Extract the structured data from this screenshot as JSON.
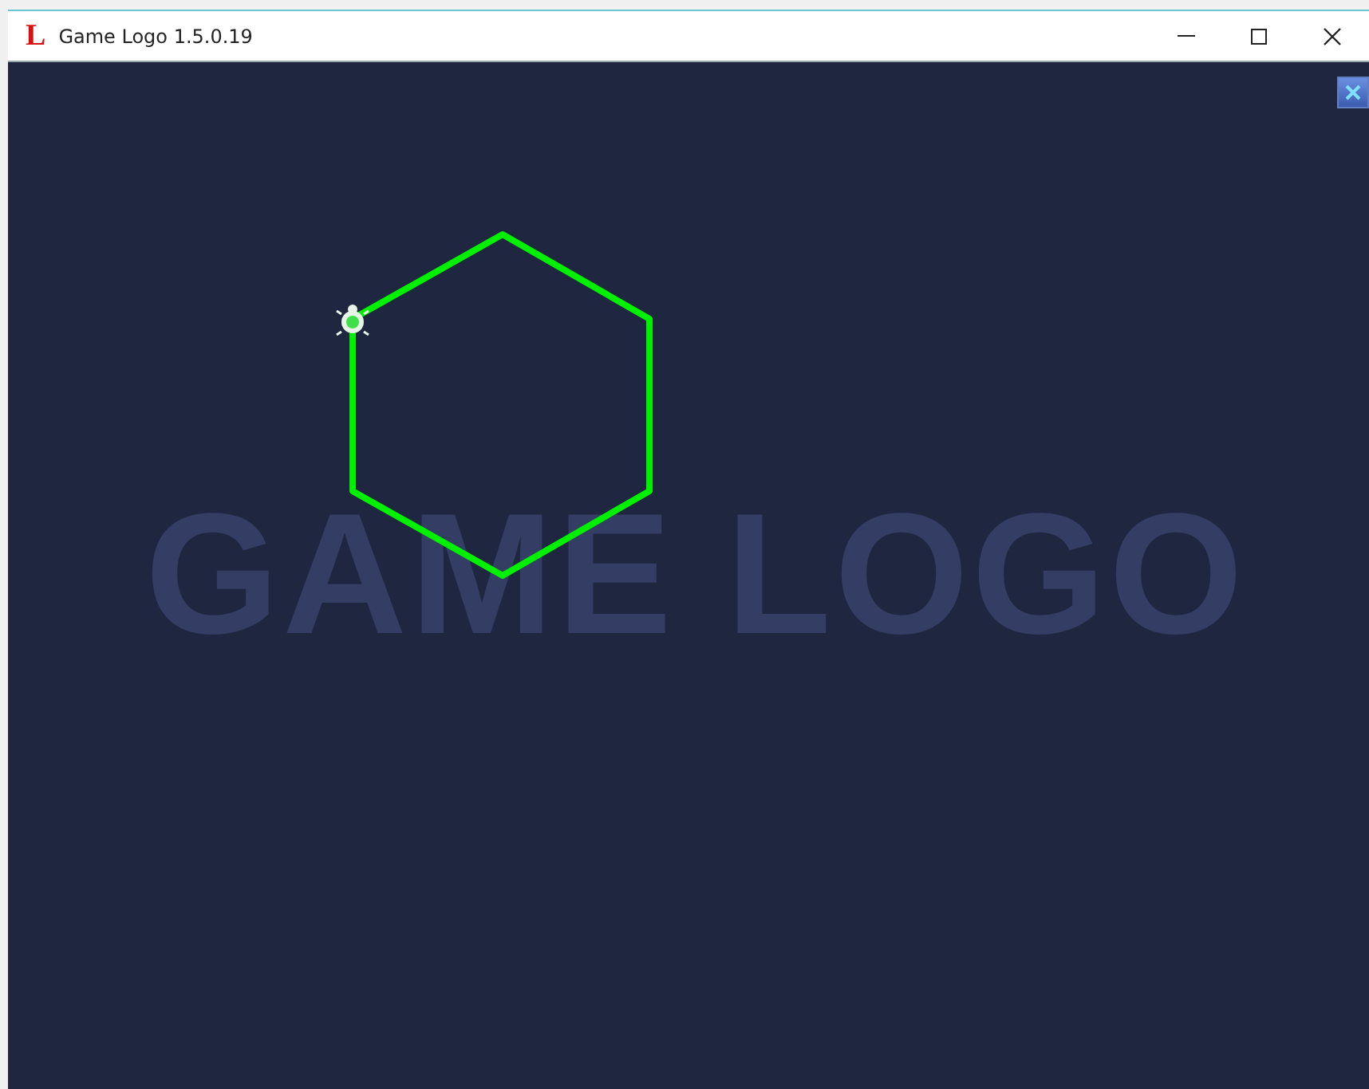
{
  "window": {
    "title": "Game Logo 1.5.0.19",
    "icon_letter": "L"
  },
  "canvas": {
    "background_text": "GAME LOGO"
  }
}
